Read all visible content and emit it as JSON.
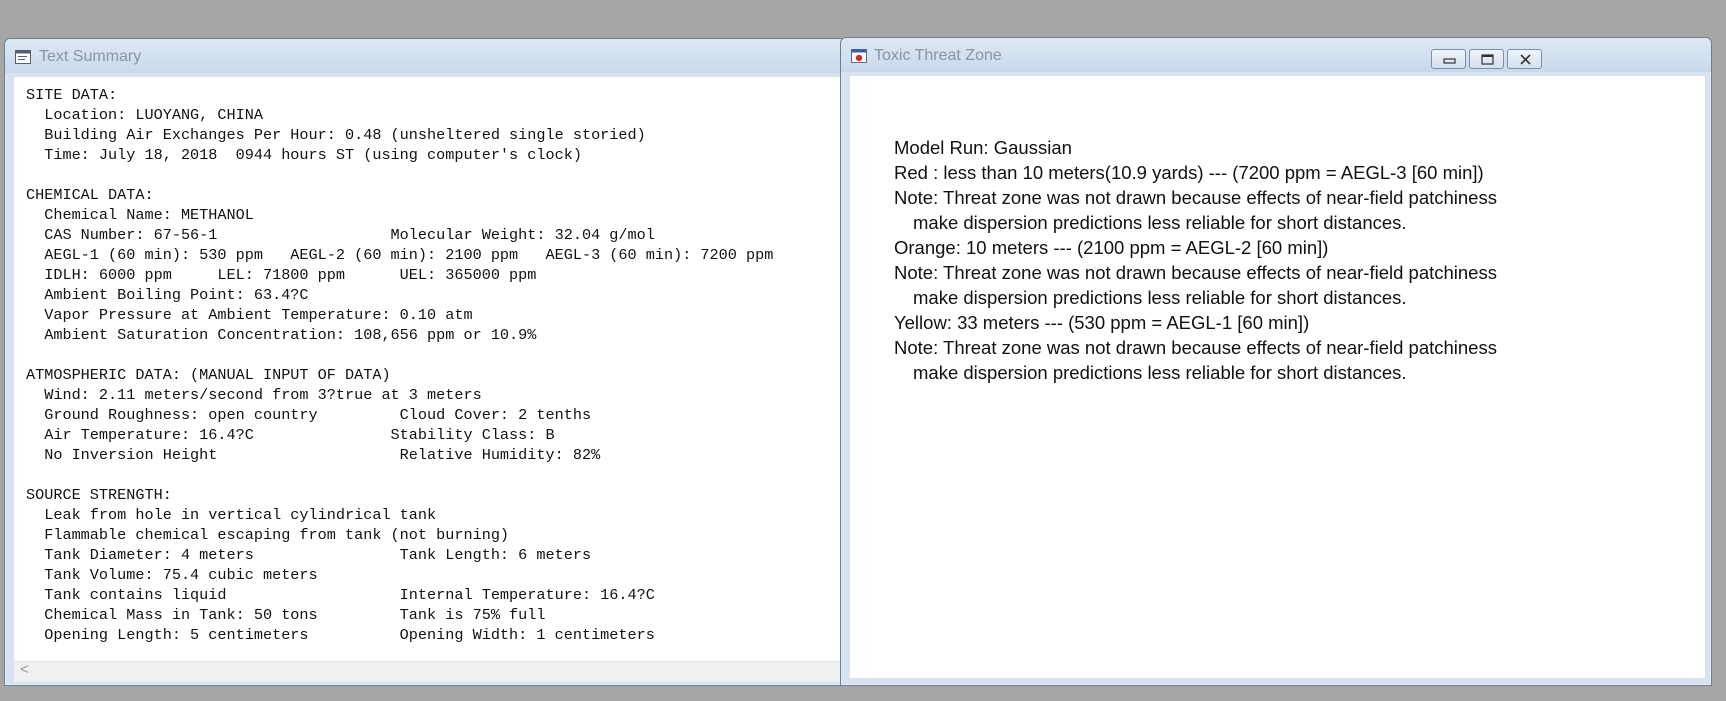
{
  "summary_window": {
    "title": "Text Summary",
    "icon": "text-document-icon",
    "lines": [
      "SITE DATA:",
      "  Location: LUOYANG, CHINA",
      "  Building Air Exchanges Per Hour: 0.48 (unsheltered single storied)",
      "  Time: July 18, 2018  0944 hours ST (using computer's clock)",
      "",
      "CHEMICAL DATA:",
      "  Chemical Name: METHANOL",
      "  CAS Number: 67-56-1                   Molecular Weight: 32.04 g/mol",
      "  AEGL-1 (60 min): 530 ppm   AEGL-2 (60 min): 2100 ppm   AEGL-3 (60 min): 7200 ppm",
      "  IDLH: 6000 ppm     LEL: 71800 ppm      UEL: 365000 ppm",
      "  Ambient Boiling Point: 63.4?C",
      "  Vapor Pressure at Ambient Temperature: 0.10 atm",
      "  Ambient Saturation Concentration: 108,656 ppm or 10.9%",
      "",
      "ATMOSPHERIC DATA: (MANUAL INPUT OF DATA)",
      "  Wind: 2.11 meters/second from 3?true at 3 meters",
      "  Ground Roughness: open country         Cloud Cover: 2 tenths",
      "  Air Temperature: 16.4?C               Stability Class: B",
      "  No Inversion Height                    Relative Humidity: 82%",
      "",
      "SOURCE STRENGTH:",
      "  Leak from hole in vertical cylindrical tank",
      "  Flammable chemical escaping from tank (not burning)",
      "  Tank Diameter: 4 meters                Tank Length: 6 meters",
      "  Tank Volume: 75.4 cubic meters",
      "  Tank contains liquid                   Internal Temperature: 16.4?C",
      "  Chemical Mass in Tank: 50 tons         Tank is 75% full",
      "  Opening Length: 5 centimeters          Opening Width: 1 centimeters"
    ],
    "scroll_left": "<"
  },
  "threat_window": {
    "title": "Toxic Threat Zone",
    "icon": "threat-zone-icon",
    "buttons": {
      "minimize": "minimize-icon",
      "maximize": "maximize-icon",
      "close": "close-icon"
    },
    "lines": [
      {
        "text": "Model Run: Gaussian",
        "indent": false
      },
      {
        "text": "Red   : less than 10 meters(10.9 yards) --- (7200 ppm = AEGL-3 [60 min])",
        "indent": false
      },
      {
        "text": "Note: Threat zone was not drawn because effects of near-field patchiness",
        "indent": false
      },
      {
        "text": "make dispersion predictions less reliable for short distances.",
        "indent": true
      },
      {
        "text": "Orange: 10 meters --- (2100 ppm = AEGL-2 [60 min])",
        "indent": false
      },
      {
        "text": "Note: Threat zone was not drawn because effects of near-field patchiness",
        "indent": false
      },
      {
        "text": "make dispersion predictions less reliable for short distances.",
        "indent": true
      },
      {
        "text": "Yellow: 33 meters --- (530 ppm = AEGL-1 [60 min])",
        "indent": false
      },
      {
        "text": "Note: Threat zone was not drawn because effects of near-field patchiness",
        "indent": false
      },
      {
        "text": "make dispersion predictions less reliable for short distances.",
        "indent": true
      }
    ]
  },
  "colors": {
    "desktop": "#a6a6a6",
    "title_text": "#8a94a2",
    "window_frame": "#d7e3f1"
  }
}
